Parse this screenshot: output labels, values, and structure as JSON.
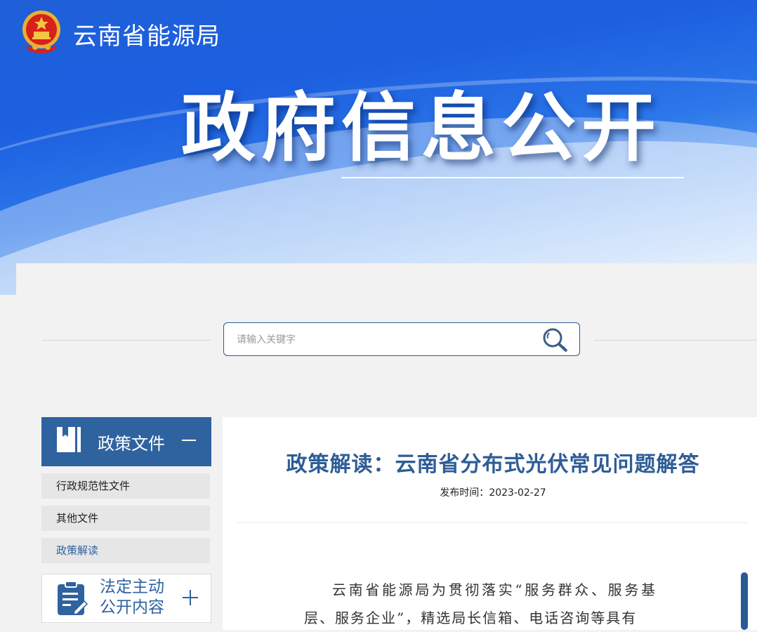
{
  "header": {
    "org_name": "云南省能源局",
    "section_title": "政府信息公开"
  },
  "search": {
    "placeholder": "请输入关键字"
  },
  "sidebar": {
    "group1": {
      "label": "政策文件",
      "items": [
        {
          "label": "行政规范性文件"
        },
        {
          "label": "其他文件"
        },
        {
          "label": "政策解读",
          "active": true
        }
      ]
    },
    "group2": {
      "label": "法定主动公开内容"
    }
  },
  "article": {
    "title": "政策解读：云南省分布式光伏常见问题解答",
    "date_label": "发布时间：",
    "date": "2023-02-27",
    "body": "云南省能源局为贯彻落实“服务群众、服务基层、服务企业”，精选局长信箱、电话咨询等具有"
  },
  "colors": {
    "brand_blue": "#2f63a0",
    "title_blue": "#2e5d96"
  }
}
